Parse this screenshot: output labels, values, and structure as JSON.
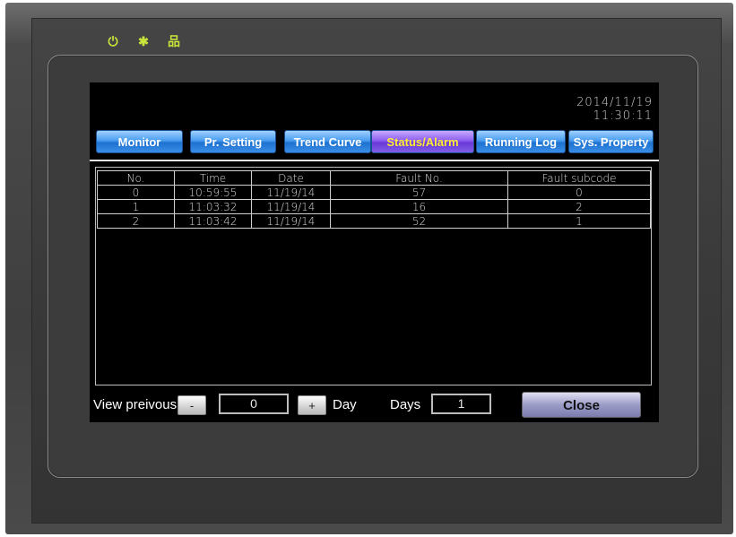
{
  "screen": {
    "date": "2014/11/19",
    "time": "11:30:11",
    "tabs": [
      {
        "label": "Monitor"
      },
      {
        "label": "Pr. Setting"
      },
      {
        "label": "Trend Curve"
      },
      {
        "label": "Status/Alarm"
      },
      {
        "label": "Running Log"
      },
      {
        "label": "Sys. Property"
      }
    ],
    "active_tab": "Status/Alarm",
    "table": {
      "headers": [
        "No.",
        "Time",
        "Date",
        "Fault No.",
        "Fault subcode"
      ],
      "rows": [
        [
          "0",
          "10:59:55",
          "11/19/14",
          "57",
          "0"
        ],
        [
          "1",
          "11:03:32",
          "11/19/14",
          "16",
          "2"
        ],
        [
          "2",
          "11:03:42",
          "11/19/14",
          "52",
          "1"
        ]
      ]
    },
    "bottom": {
      "view_previous_label": "View preivous",
      "minus_label": "-",
      "offset_value": "0",
      "plus_label": "+",
      "day_label": "Day",
      "days_label": "Days",
      "days_value": "1",
      "close_label": "Close"
    }
  },
  "colors": {
    "tab": "#3a8ee6",
    "tab_active_text": "#ffee33",
    "led": "#c8e43a"
  }
}
